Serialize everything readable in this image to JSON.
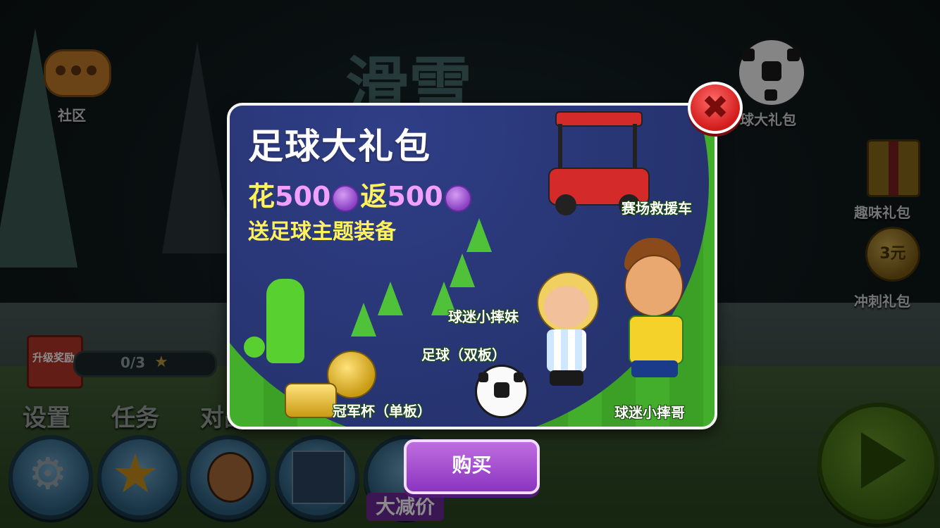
{
  "game": {
    "logo_text": "滑雪"
  },
  "left_menu": {
    "community_label": "社区",
    "upgrade_reward_label": "升级奖励",
    "progress_text": "0/3"
  },
  "right_menu": {
    "football_pack_label": "球大礼包",
    "fun_pack_label": "趣味礼包",
    "sprint_pack_label": "冲刺礼包",
    "sprint_coin_text": "3元"
  },
  "bottom_menu": {
    "settings_label": "设置",
    "tasks_label": "任务",
    "battle_label": "对战",
    "discount_badge": "大减价"
  },
  "modal": {
    "title": "足球大礼包",
    "promo_spend_prefix": "花",
    "promo_spend_amount": "500",
    "promo_return_prefix": "返",
    "promo_return_amount": "500",
    "subtitle": "送足球主题装备",
    "items": {
      "cart": "赛场救援车",
      "girl_fan": "球迷小摔妹",
      "football": "足球（双板）",
      "trophy": "冠军杯（单板）",
      "boy_fan": "球迷小摔哥"
    },
    "close_symbol": "✖",
    "buy_label": "购买"
  },
  "colors": {
    "night_sky": "#2f3e86",
    "field_green": "#43ad2c",
    "promo_yellow": "#fff25a",
    "coin_purple": "#8a42c4",
    "buy_purple": "#a24fd0",
    "close_red": "#d21b1b"
  },
  "icons": [
    "chat-bubble-icon",
    "gift-box-icon",
    "star-icon",
    "soccer-ball-icon",
    "gear-icon",
    "avatar-icon",
    "play-icon",
    "coin-icon",
    "close-icon"
  ]
}
